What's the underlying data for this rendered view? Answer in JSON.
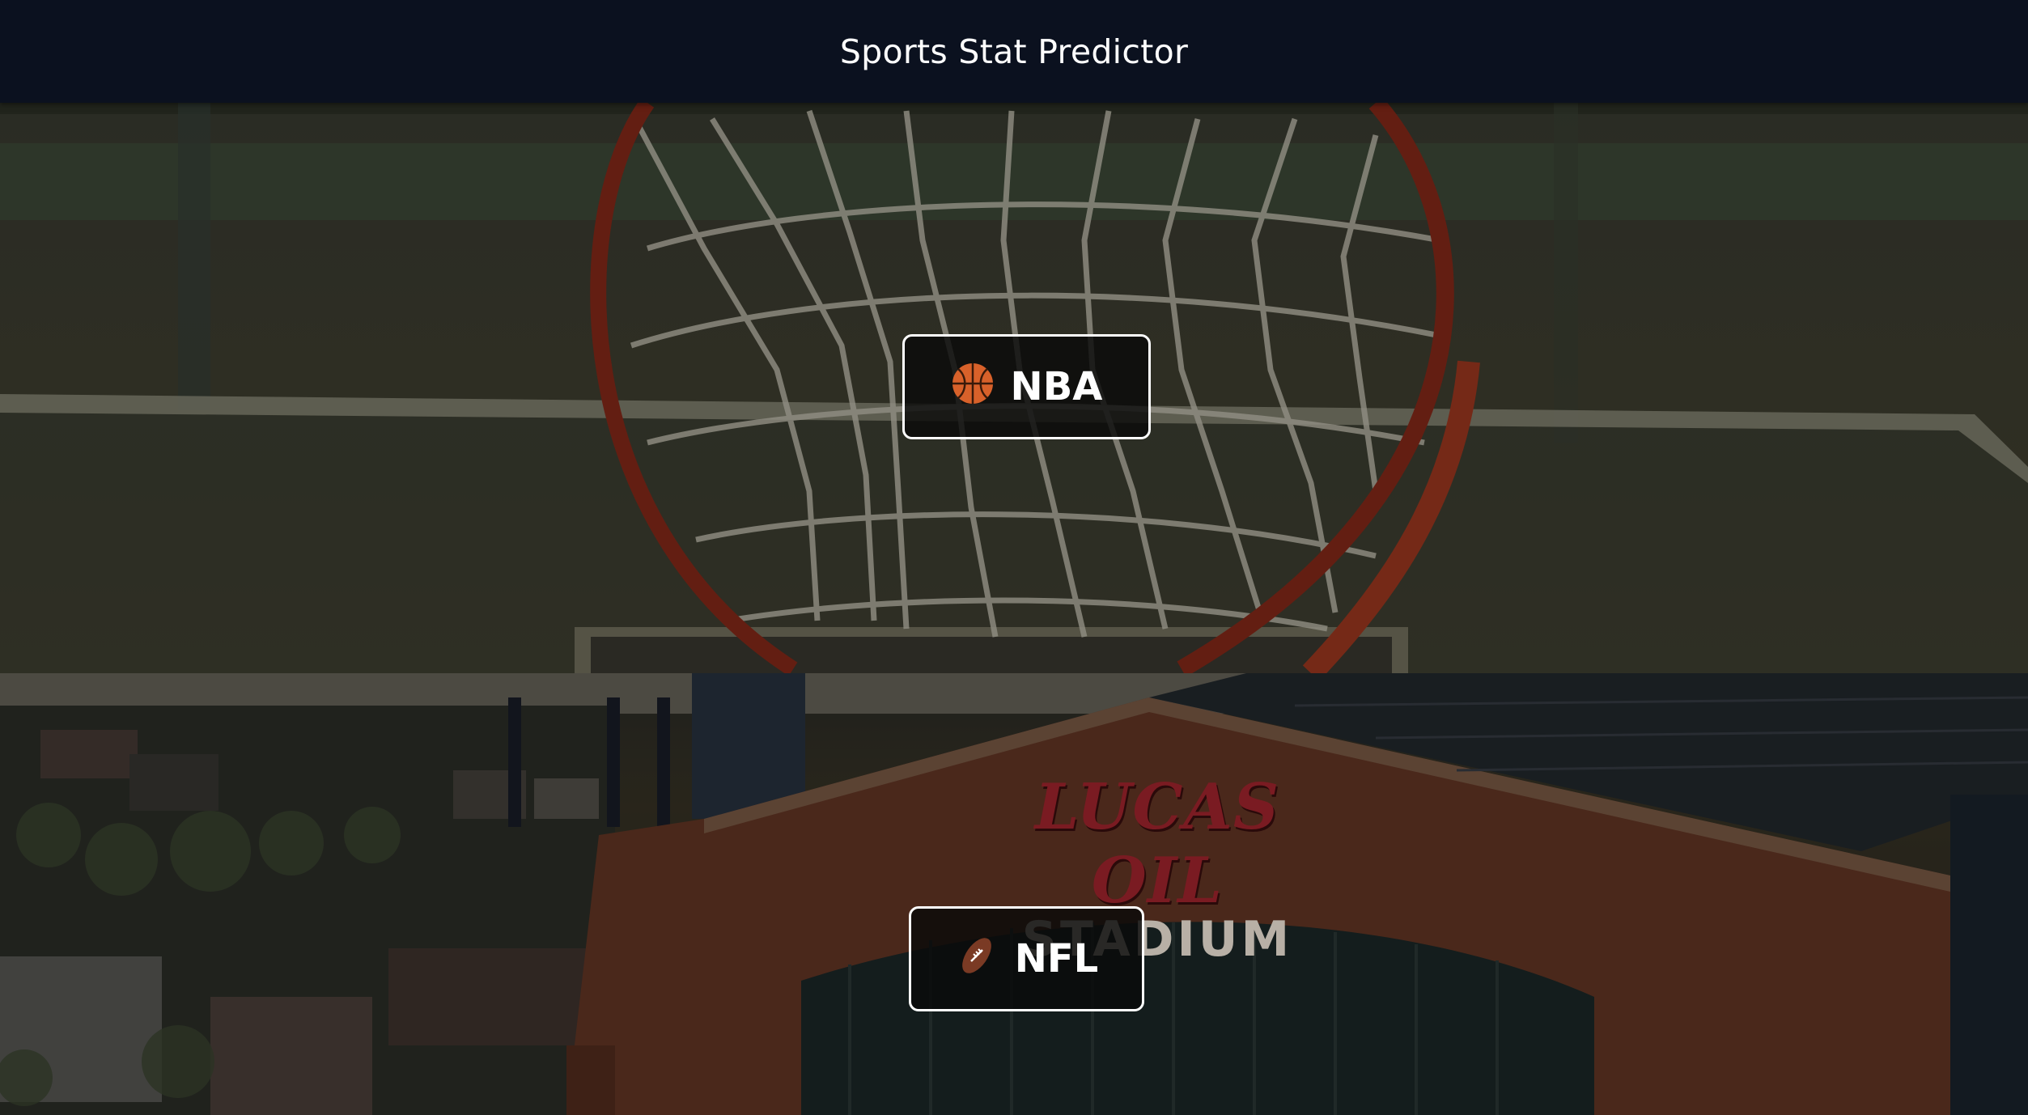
{
  "header": {
    "title": "Sports Stat Predictor"
  },
  "sections": {
    "nba": {
      "label": "NBA",
      "icon": "basketball-icon",
      "background_scene": "basketball-hoop-net"
    },
    "nfl": {
      "label": "NFL",
      "icon": "football-icon",
      "background_scene": "stadium-aerial-city",
      "sign_line1": "LUCAS OIL",
      "sign_line2": "STADIUM"
    }
  },
  "colors": {
    "header_bg": "#0b111f",
    "button_bg": "#0a0a0a",
    "button_border": "#ffffff",
    "rim": "#8a2a1a",
    "brick": "#6a3a28"
  }
}
